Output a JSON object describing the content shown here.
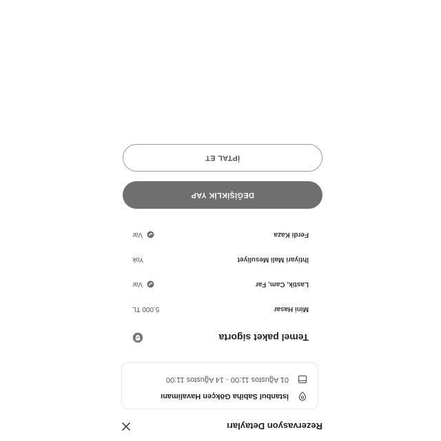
{
  "header": {
    "title": "Rezervasyon Detayları"
  },
  "trip": {
    "location": "İstanbul Sabiha Gökçen Havalimanı",
    "dates": "01 Ağustos 11:00 - 14 Ağustos 11:00"
  },
  "insurance": {
    "title": "Temel paket sigorta",
    "items": [
      {
        "label": "Mini Hasar",
        "value": "5.000 TL"
      },
      {
        "label": "Lastik, Cam, Far",
        "value": "Var"
      },
      {
        "label": "İhtiyari Mali Mesuliyet",
        "value": "Yok"
      },
      {
        "label": "Ferdi Kaza",
        "value": "Var"
      }
    ]
  },
  "actions": {
    "modify_label": "DEĞİŞİKLİK YAP",
    "cancel_label": "İPTAL ET"
  }
}
